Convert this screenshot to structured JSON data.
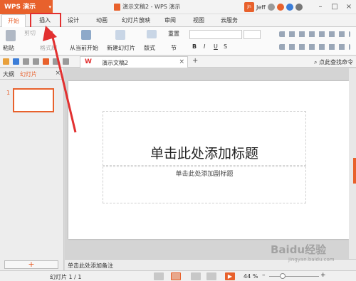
{
  "app": {
    "logo": "WPS 演示",
    "window_title": "演示文稿2 - WPS 演示",
    "user": "Jeff",
    "avatar_text": "Jn"
  },
  "tabs": [
    "开始",
    "插入",
    "设计",
    "动画",
    "幻灯片放映",
    "审阅",
    "视图",
    "云服务"
  ],
  "ribbon": {
    "paste": "粘贴",
    "cut": "剪切",
    "format_painter": "格式刷",
    "from_current": "从当前开始",
    "new_slide": "新建幻灯片",
    "layout": "版式",
    "reset": "重置",
    "section": "节"
  },
  "doc_tab": {
    "title": "演示文稿2",
    "close": "×",
    "add": "+"
  },
  "search_command": "点此查找命令",
  "left_panel": {
    "outline_tab": "大纲",
    "slides_tab": "幻灯片",
    "close": "×",
    "thumb_number": "1",
    "add_button": "+"
  },
  "slide": {
    "title_placeholder": "单击此处添加标题",
    "subtitle_placeholder": "单击此处添加副标题"
  },
  "notes_placeholder": "单击此处添加备注",
  "status": {
    "slide_count": "幻灯片 1 / 1",
    "zoom": "44 %",
    "zoom_level": 44
  },
  "watermark": {
    "main": "Baidu经验",
    "sub": "jingyan.baidu.com"
  },
  "colors": {
    "accent": "#e8612c",
    "annotation": "#e23030"
  }
}
